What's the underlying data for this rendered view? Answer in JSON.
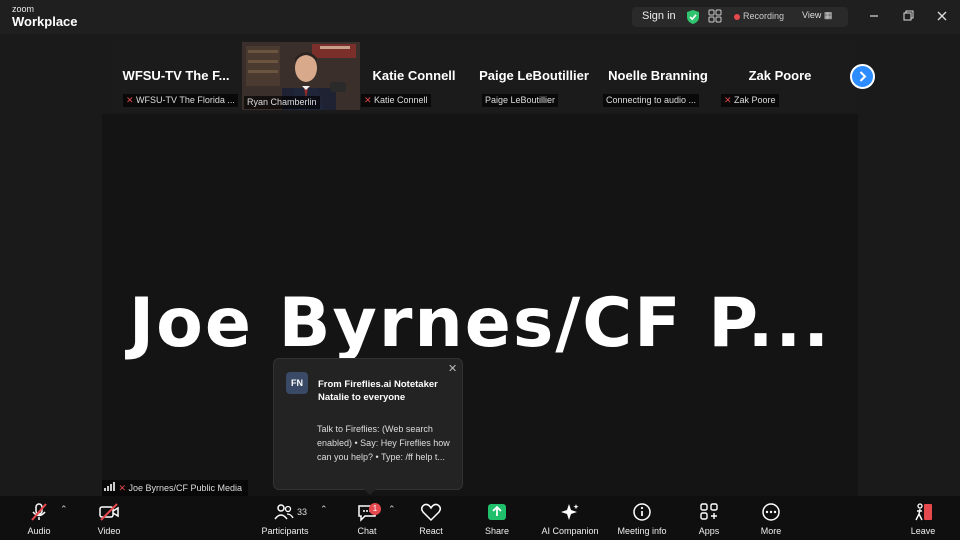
{
  "app": {
    "brand_top": "zoom",
    "brand_bottom": "Workplace"
  },
  "titlebar": {
    "sign_in": "Sign in",
    "recording": "Recording",
    "view": "View"
  },
  "gallery": {
    "tiles": [
      {
        "name": "WFSU-TV The F...",
        "label": "WFSU-TV The Florida ..."
      },
      {
        "name": "",
        "label": "Ryan Chamberlin"
      },
      {
        "name": "Katie Connell",
        "label": "Katie Connell"
      },
      {
        "name": "Paige LeBoutillier",
        "label": "Paige LeBoutillier"
      },
      {
        "name": "Noelle Branning",
        "label": "Connecting to audio ..."
      },
      {
        "name": "Zak Poore",
        "label": "Zak Poore"
      }
    ]
  },
  "stage": {
    "speaker_name": "Joe Byrnes/CF P...",
    "speaker_label": "Joe Byrnes/CF Public Media"
  },
  "chat_popup": {
    "avatar": "FN",
    "title": "From Fireflies.ai Notetaker Natalie to everyone",
    "message": "Talk to Fireflies: (Web search enabled) • Say: Hey Fireflies how can you help? • Type: /ff help t..."
  },
  "toolbar": {
    "audio": "Audio",
    "video": "Video",
    "participants": "Participants",
    "participant_count": "33",
    "chat": "Chat",
    "chat_badge": "1",
    "react": "React",
    "share": "Share",
    "ai_companion": "AI Companion",
    "meeting_info": "Meeting info",
    "apps": "Apps",
    "more": "More",
    "leave": "Leave"
  },
  "colors": {
    "accent": "#2d8cff",
    "record": "#e5484d",
    "share": "#1fbf6b",
    "shield": "#2fc46d"
  }
}
